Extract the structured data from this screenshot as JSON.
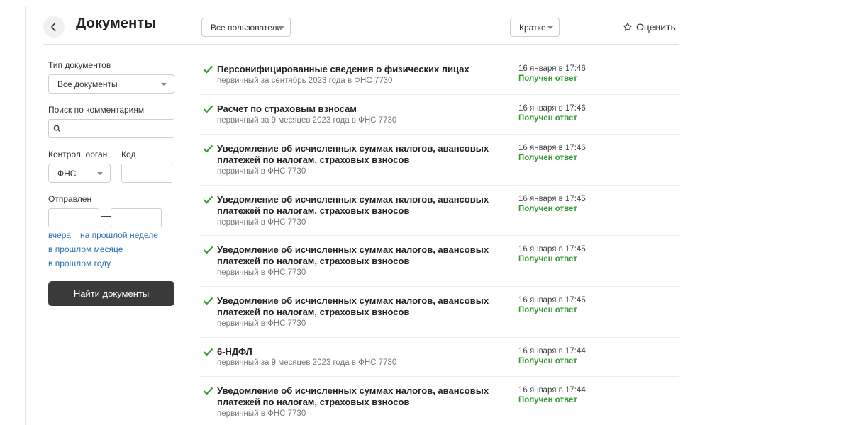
{
  "header": {
    "title": "Документы",
    "users_filter": "Все пользователи",
    "view_mode": "Кратко",
    "rate_label": "Оценить"
  },
  "filters": {
    "doc_type_label": "Тип документов",
    "doc_type_value": "Все документы",
    "comment_search_label": "Поиск по комментариям",
    "comment_search_value": "",
    "control_org_label": "Контрол. орган",
    "control_org_value": "ФНС",
    "code_label": "Код",
    "code_value": "",
    "sent_label": "Отправлен",
    "sent_from": "",
    "sent_to": "",
    "dash": "—",
    "quick": [
      "вчера",
      "на прошлой неделе",
      "в прошлом месяце",
      "в прошлом году"
    ],
    "find_button": "Найти документы"
  },
  "documents": [
    {
      "title": "Персонифицированные сведения о физических лицах",
      "subtitle": "первичный за сентябрь 2023 года в ФНС 7730",
      "date": "16 января в 17:46",
      "status": "Получен ответ"
    },
    {
      "title": "Расчет по страховым взносам",
      "subtitle": "первичный за 9 месяцев 2023 года в ФНС 7730",
      "date": "16 января в 17:46",
      "status": "Получен ответ"
    },
    {
      "title": "Уведомление об исчисленных суммах налогов, авансовых платежей по налогам, страховых взносов",
      "subtitle": "первичный в ФНС 7730",
      "date": "16 января в 17:46",
      "status": "Получен ответ"
    },
    {
      "title": "Уведомление об исчисленных суммах налогов, авансовых платежей по налогам, страховых взносов",
      "subtitle": "первичный в ФНС 7730",
      "date": "16 января в 17:45",
      "status": "Получен ответ"
    },
    {
      "title": "Уведомление об исчисленных суммах налогов, авансовых платежей по налогам, страховых взносов",
      "subtitle": "первичный в ФНС 7730",
      "date": "16 января в 17:45",
      "status": "Получен ответ"
    },
    {
      "title": "Уведомление об исчисленных суммах налогов, авансовых платежей по налогам, страховых взносов",
      "subtitle": "первичный в ФНС 7730",
      "date": "16 января в 17:45",
      "status": "Получен ответ"
    },
    {
      "title": "6-НДФЛ",
      "subtitle": "первичный за 9 месяцев 2023 года в ФНС 7730",
      "date": "16 января в 17:44",
      "status": "Получен ответ"
    },
    {
      "title": "Уведомление об исчисленных суммах налогов, авансовых платежей по налогам, страховых взносов",
      "subtitle": "первичный в ФНС 7730",
      "date": "16 января в 17:44",
      "status": "Получен ответ"
    }
  ],
  "colors": {
    "status": "#3a9a3a",
    "link": "#2a6fb0",
    "button": "#3a3a3a"
  },
  "icons": {
    "back": "chevron-left-icon",
    "rate": "star-icon",
    "search": "search-icon",
    "done": "checkmark-icon"
  }
}
